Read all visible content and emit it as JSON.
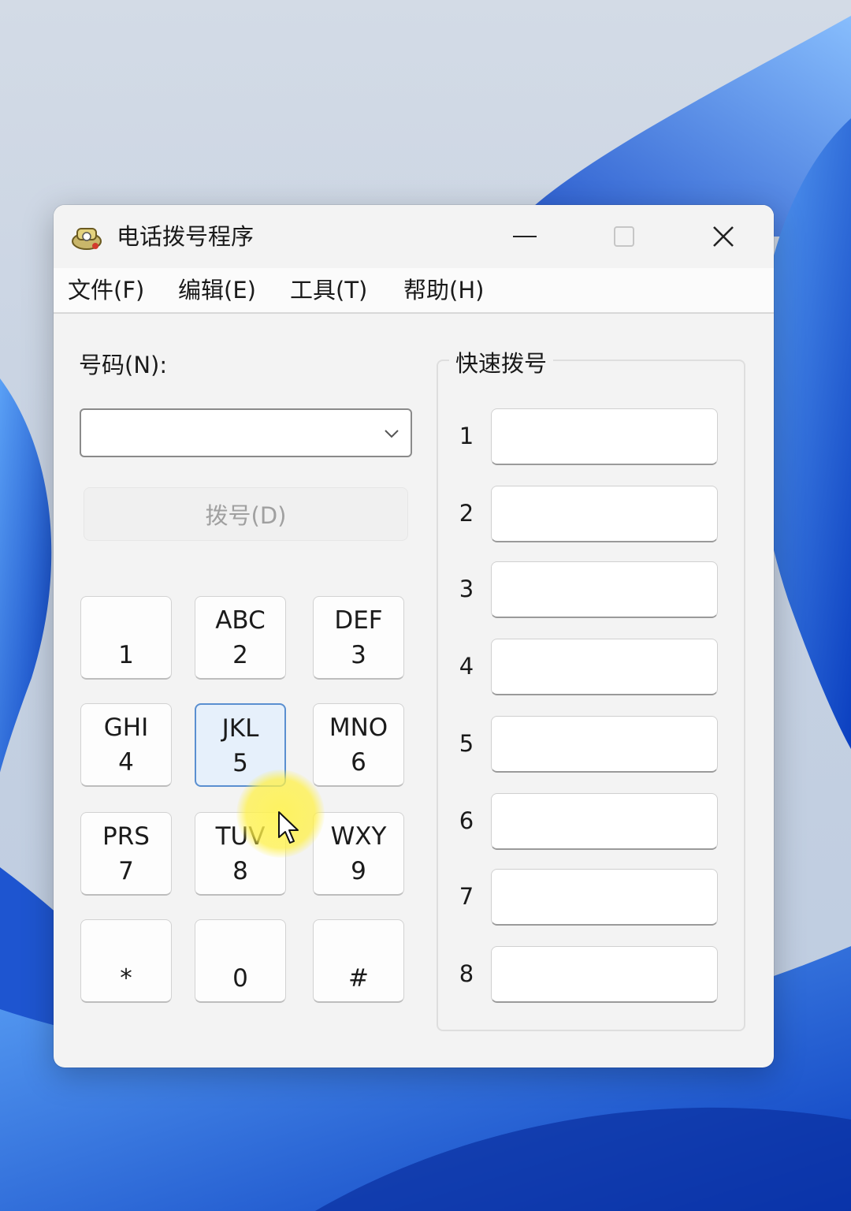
{
  "window": {
    "title": "电话拨号程序",
    "controls": {
      "minimize_icon": "minimize-icon",
      "maximize_icon": "maximize-icon",
      "close_icon": "close-icon"
    }
  },
  "menu": [
    "文件(F)",
    "编辑(E)",
    "工具(T)",
    "帮助(H)"
  ],
  "number": {
    "label": "号码(N):",
    "value": "",
    "dropdown_icon": "chevron-down-icon"
  },
  "dial_button": {
    "label": "拨号(D)",
    "enabled": false
  },
  "keypad": [
    {
      "letters": "",
      "digit": "1"
    },
    {
      "letters": "ABC",
      "digit": "2"
    },
    {
      "letters": "DEF",
      "digit": "3"
    },
    {
      "letters": "GHI",
      "digit": "4"
    },
    {
      "letters": "JKL",
      "digit": "5"
    },
    {
      "letters": "MNO",
      "digit": "6"
    },
    {
      "letters": "PRS",
      "digit": "7"
    },
    {
      "letters": "TUV",
      "digit": "8"
    },
    {
      "letters": "WXY",
      "digit": "9"
    },
    {
      "letters": "",
      "digit": "*"
    },
    {
      "letters": "",
      "digit": "0"
    },
    {
      "letters": "",
      "digit": "#"
    }
  ],
  "speed_dial": {
    "title": "快速拨号",
    "entries": [
      {
        "num": "1",
        "value": ""
      },
      {
        "num": "2",
        "value": ""
      },
      {
        "num": "3",
        "value": ""
      },
      {
        "num": "4",
        "value": ""
      },
      {
        "num": "5",
        "value": ""
      },
      {
        "num": "6",
        "value": ""
      },
      {
        "num": "7",
        "value": ""
      },
      {
        "num": "8",
        "value": ""
      }
    ]
  },
  "colors": {
    "accent": "#5a8fd0",
    "cursor_highlight": "#fff350",
    "wallpaper": "#1f5fd6"
  }
}
